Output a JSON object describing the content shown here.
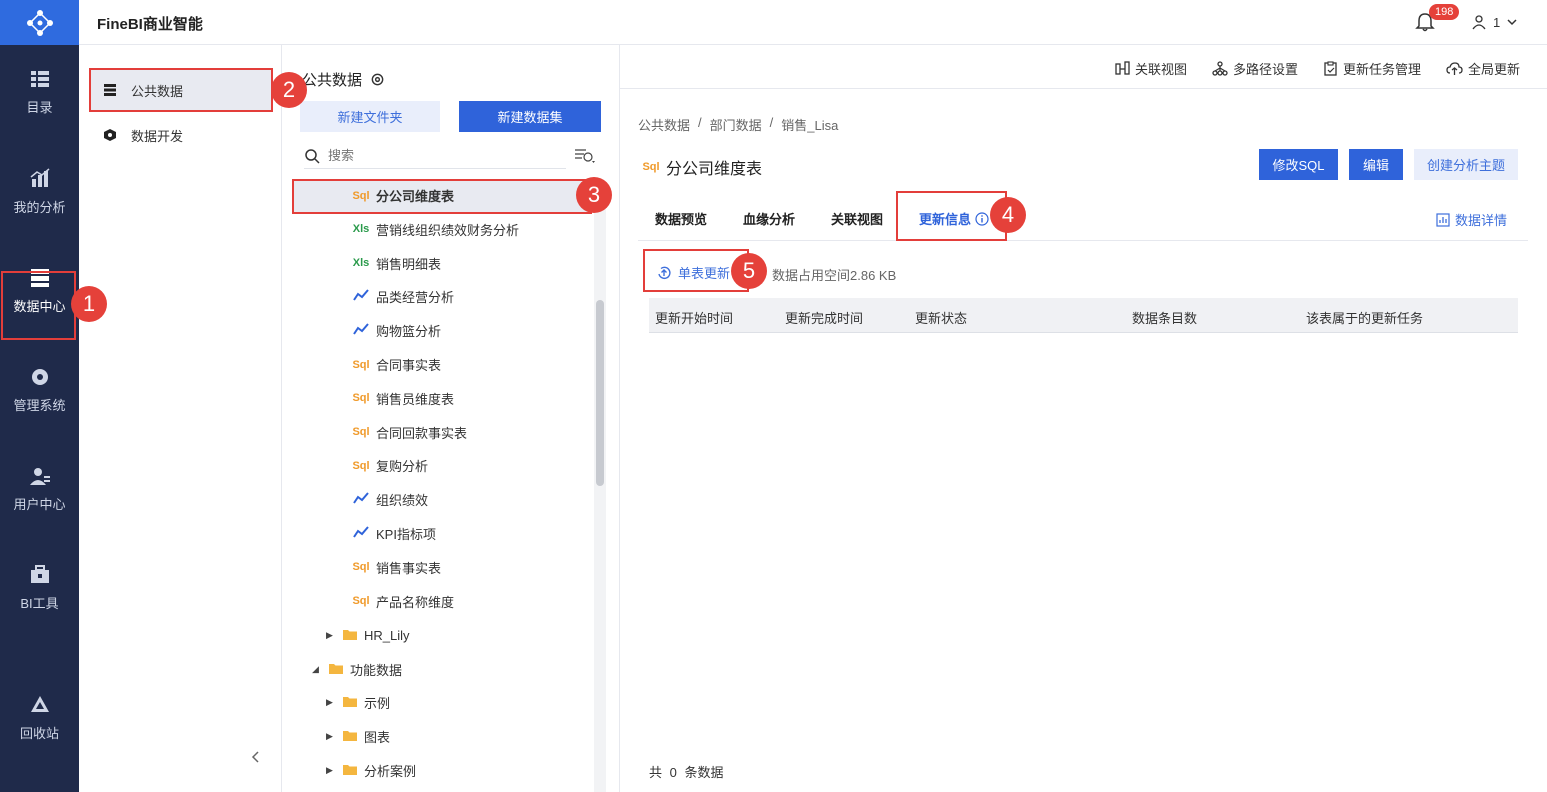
{
  "app": {
    "title": "FineBI商业智能",
    "notification_count": "198",
    "user": "1"
  },
  "nav": [
    {
      "label": "目录",
      "icon": "catalog-icon"
    },
    {
      "label": "我的分析",
      "icon": "analysis-icon"
    },
    {
      "label": "数据中心",
      "icon": "data-center-icon"
    },
    {
      "label": "管理系统",
      "icon": "gear-icon"
    },
    {
      "label": "用户中心",
      "icon": "user-icon"
    },
    {
      "label": "BI工具",
      "icon": "toolbox-icon"
    },
    {
      "label": "回收站",
      "icon": "recycle-icon"
    }
  ],
  "sub_nav": [
    {
      "label": "公共数据",
      "icon": "database-icon"
    },
    {
      "label": "数据开发",
      "icon": "cube-icon"
    }
  ],
  "tree_panel": {
    "title": "公共数据",
    "new_folder": "新建文件夹",
    "new_dataset": "新建数据集",
    "search_placeholder": "搜索",
    "items": [
      {
        "type": "SQL",
        "label": "分公司维度表"
      },
      {
        "type": "XLS",
        "label": "营销线组织绩效财务分析"
      },
      {
        "type": "XLS",
        "label": "销售明细表"
      },
      {
        "type": "ANALYSIS",
        "label": "品类经营分析"
      },
      {
        "type": "ANALYSIS",
        "label": "购物篮分析"
      },
      {
        "type": "SQL",
        "label": "合同事实表"
      },
      {
        "type": "SQL",
        "label": "销售员维度表"
      },
      {
        "type": "SQL",
        "label": "合同回款事实表"
      },
      {
        "type": "SQL",
        "label": "复购分析"
      },
      {
        "type": "ANALYSIS",
        "label": "组织绩效"
      },
      {
        "type": "ANALYSIS",
        "label": "KPI指标项"
      },
      {
        "type": "SQL",
        "label": "销售事实表"
      },
      {
        "type": "SQL",
        "label": "产品名称维度"
      }
    ],
    "folders": [
      {
        "label": "HR_Lily",
        "state": "collapsed"
      },
      {
        "label": "功能数据",
        "state": "expanded"
      },
      {
        "label": "示例",
        "state": "collapsed"
      },
      {
        "label": "图表",
        "state": "collapsed"
      },
      {
        "label": "分析案例",
        "state": "collapsed"
      }
    ]
  },
  "toolbar": {
    "related_view": "关联视图",
    "multipath": "多路径设置",
    "task_manage": "更新任务管理",
    "global_update": "全局更新"
  },
  "breadcrumb": [
    "公共数据",
    "/",
    "部门数据",
    "/",
    "销售_Lisa"
  ],
  "table": {
    "type_tag": "SQL",
    "name": "分公司维度表",
    "btn_edit_sql": "修改SQL",
    "btn_edit": "编辑",
    "btn_create_topic": "创建分析主题"
  },
  "tabs": [
    "数据预览",
    "血缘分析",
    "关联视图",
    "更新信息"
  ],
  "data_detail": "数据详情",
  "update": {
    "single_update": "单表更新",
    "size_text": "数据占用空间2.86 KB"
  },
  "columns": [
    "更新开始时间",
    "更新完成时间",
    "更新状态",
    "数据条目数",
    "该表属于的更新任务"
  ],
  "footer": {
    "prefix": "共",
    "count": "0",
    "suffix": "条数据"
  },
  "steps": [
    "1",
    "2",
    "3",
    "4",
    "5"
  ]
}
